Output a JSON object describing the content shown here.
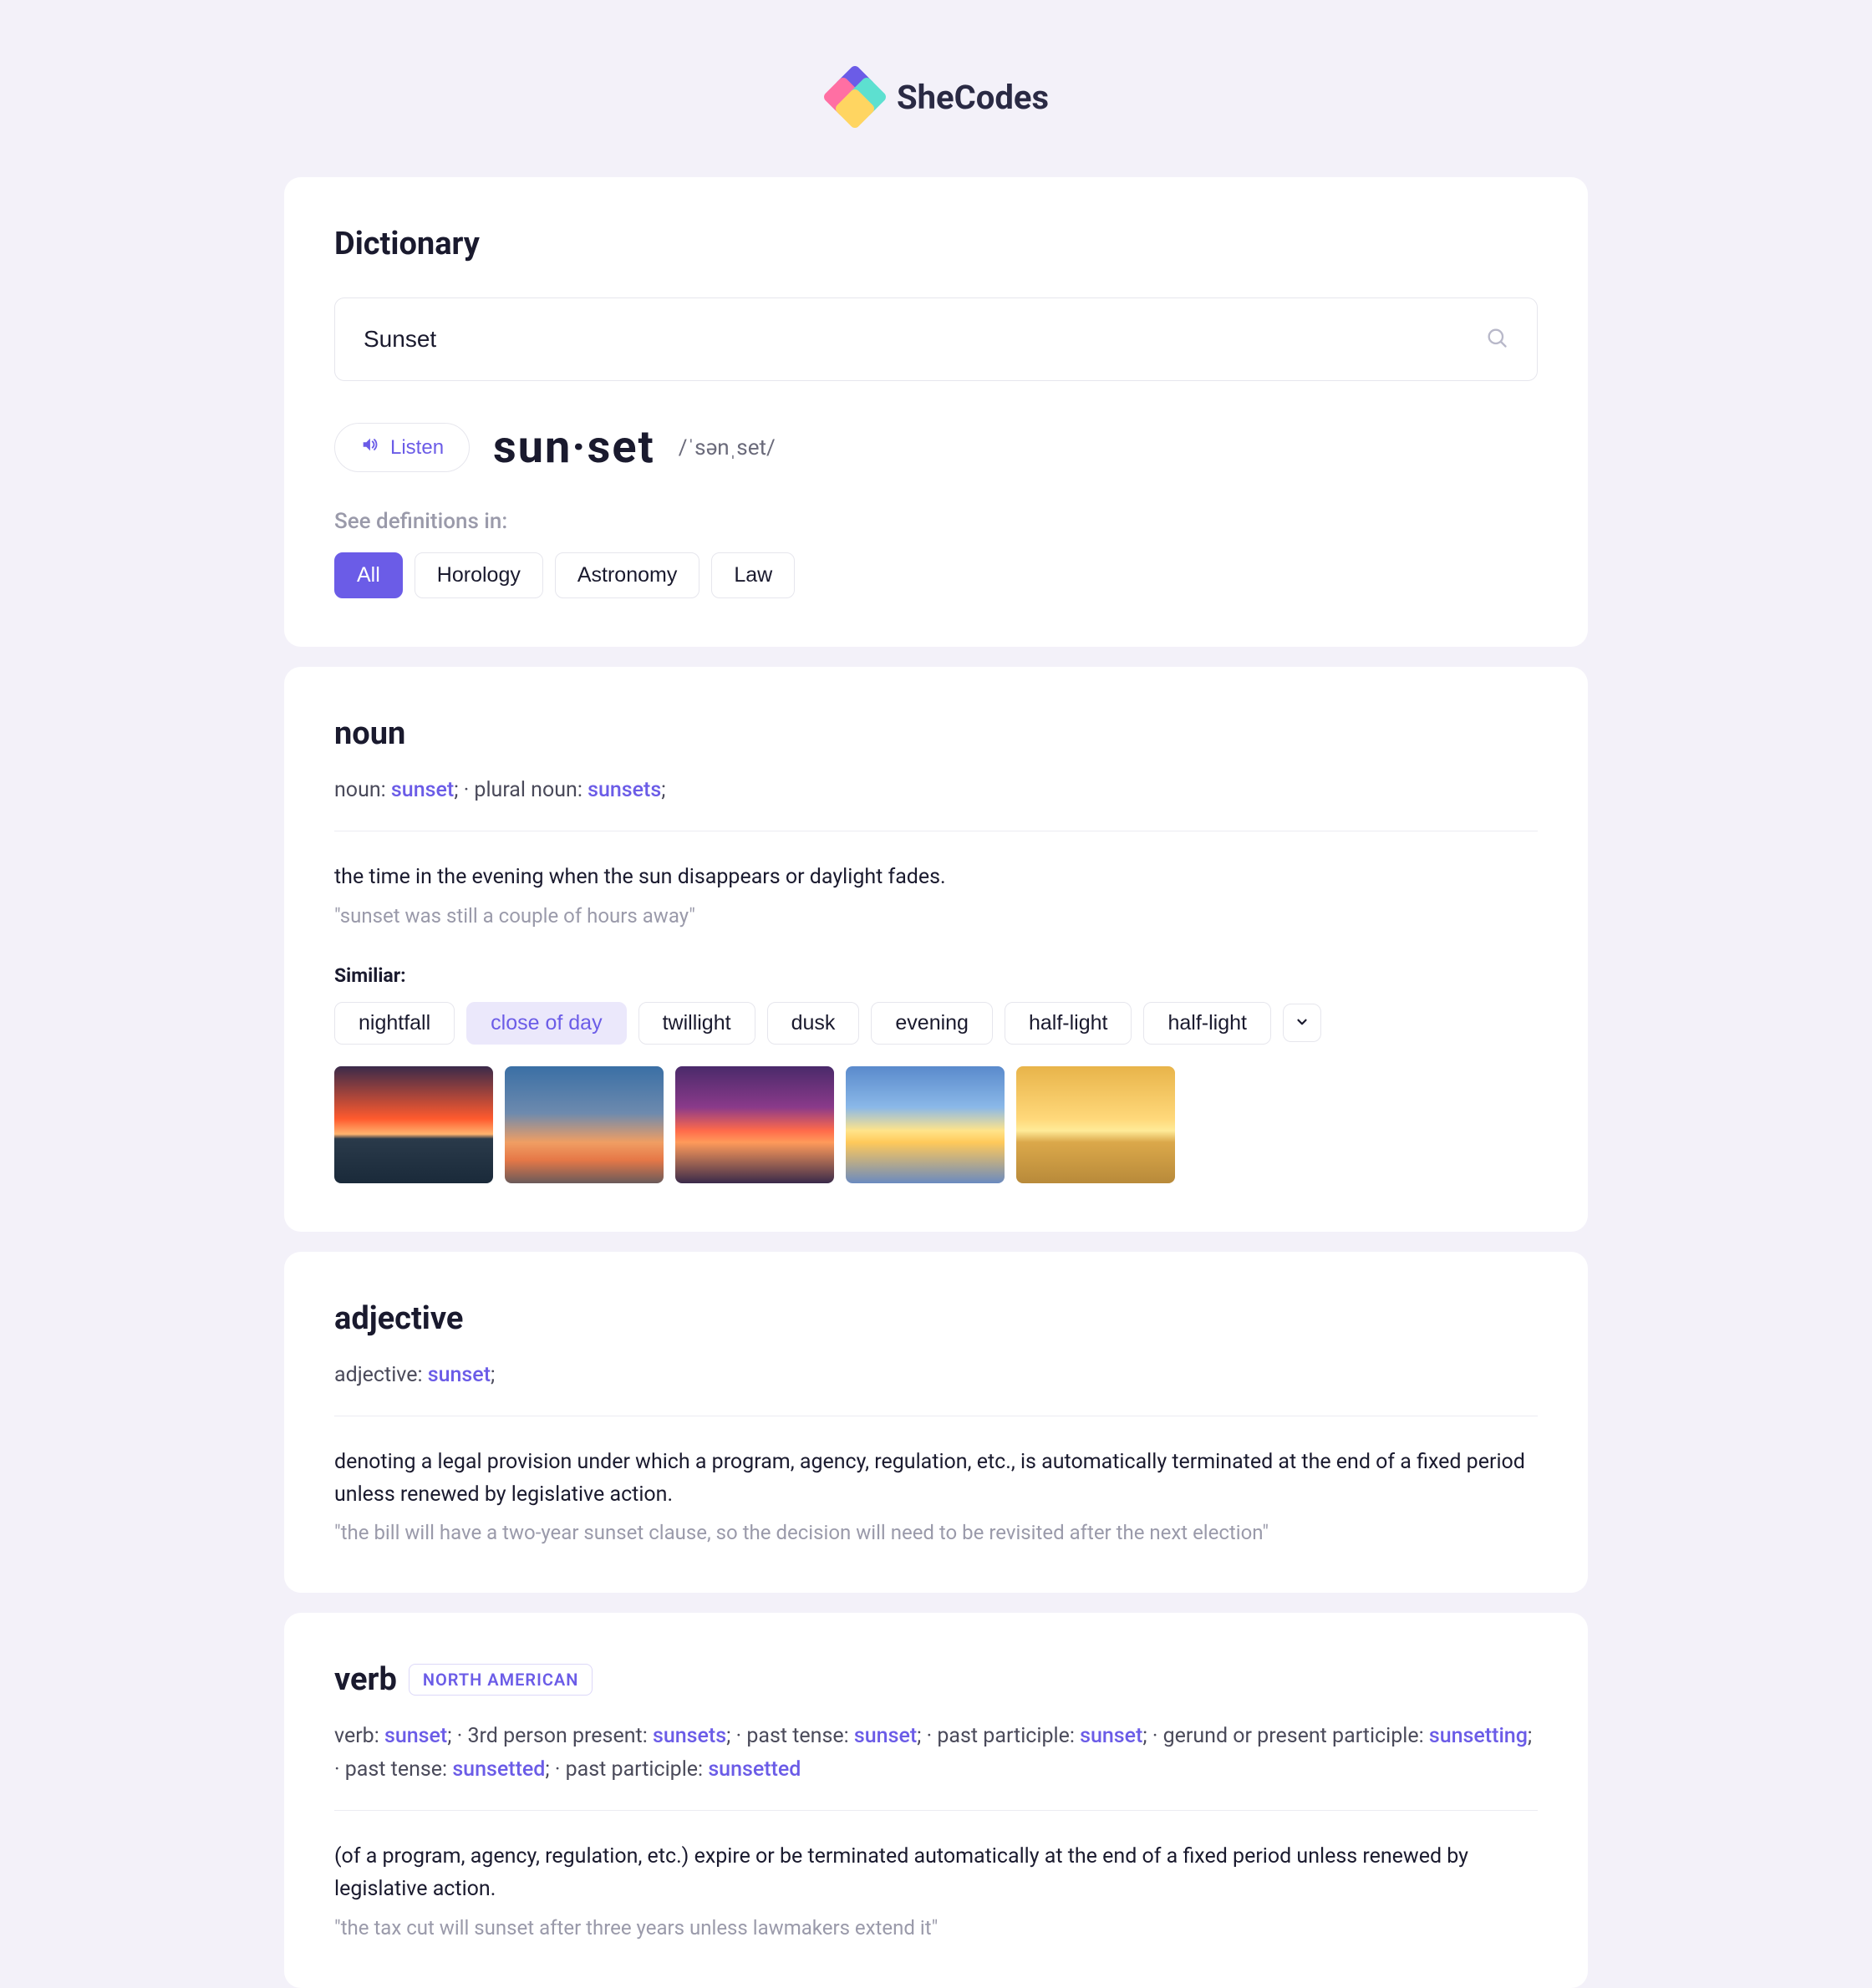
{
  "brand": {
    "name": "SheCodes"
  },
  "header": {
    "title": "Dictionary",
    "search_value": "Sunset"
  },
  "word": {
    "listen_label": "Listen",
    "headword": "sun·set",
    "phonetic": "/ˈsənˌset/"
  },
  "categories": {
    "label": "See definitions in:",
    "items": [
      "All",
      "Horology",
      "Astronomy",
      "Law"
    ]
  },
  "noun": {
    "heading": "noun",
    "forms_prefix_1": "noun: ",
    "forms_kw_1": "sunset",
    "forms_sep": ";   ·   plural noun: ",
    "forms_kw_2": "sunsets",
    "forms_suffix": ";",
    "definition": "the time in the evening when the sun disappears or daylight fades.",
    "example": "\"sunset was still a couple of hours away\""
  },
  "similar": {
    "label": "Similiar:",
    "items": [
      "nightfall",
      "close of day",
      "twillight",
      "dusk",
      "evening",
      "half-light",
      "half-light"
    ]
  },
  "adjective": {
    "heading": "adjective",
    "forms_prefix": "adjective: ",
    "forms_kw": "sunset",
    "forms_suffix": ";",
    "definition": "denoting a legal provision under which a program, agency, regulation, etc., is automatically terminated at the end of a fixed period unless renewed by legislative action.",
    "example": "\"the bill will have a two-year sunset clause, so the decision will need to be revisited after the next election\""
  },
  "verb": {
    "heading": "verb",
    "badge": "NORTH AMERICAN",
    "forms": {
      "p1": "verb: ",
      "k1": "sunset",
      "p2": ";   ·   3rd person present: ",
      "k2": "sunsets",
      "p3": ";   ·   past tense: ",
      "k3": "sunset",
      "p4": ";   ·   past participle: ",
      "k4": "sunset",
      "p5": ";   ·   gerund or present participle: ",
      "k5": "sunsetting",
      "p6": ";   ·   past tense: ",
      "k6": "sunsetted",
      "p7": ";   ·   past participle: ",
      "k7": "sunsetted"
    },
    "definition": "(of a program, agency, regulation, etc.) expire or be terminated automatically at the end of a fixed period unless renewed by legislative action.",
    "example": "\"the tax cut will sunset after three years unless lawmakers extend it\""
  }
}
